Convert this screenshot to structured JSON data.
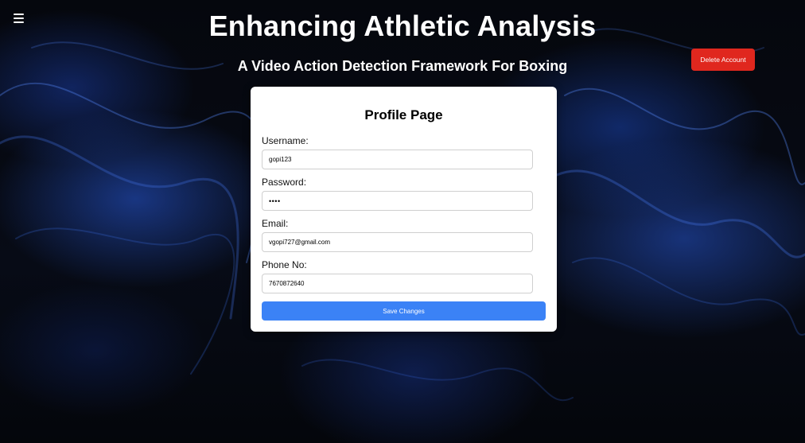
{
  "header": {
    "title": "Enhancing Athletic Analysis",
    "subtitle": "A Video Action Detection Framework For Boxing",
    "menu_icon": "hamburger-menu-icon",
    "delete_account_label": "Delete Account"
  },
  "profile_form": {
    "title": "Profile Page",
    "username": {
      "label": "Username:",
      "value": "gopi123"
    },
    "password": {
      "label": "Password:",
      "value": "gopi"
    },
    "email": {
      "label": "Email:",
      "value": "vgopi727@gmail.com"
    },
    "phone": {
      "label": "Phone No:",
      "value": "7670872640"
    },
    "save_label": "Save Changes"
  },
  "colors": {
    "delete_button": "#e0271e",
    "save_button": "#3b82f6",
    "card_background": "#ffffff",
    "page_background": "#05070d",
    "accent_glow": "#2a5adc"
  }
}
